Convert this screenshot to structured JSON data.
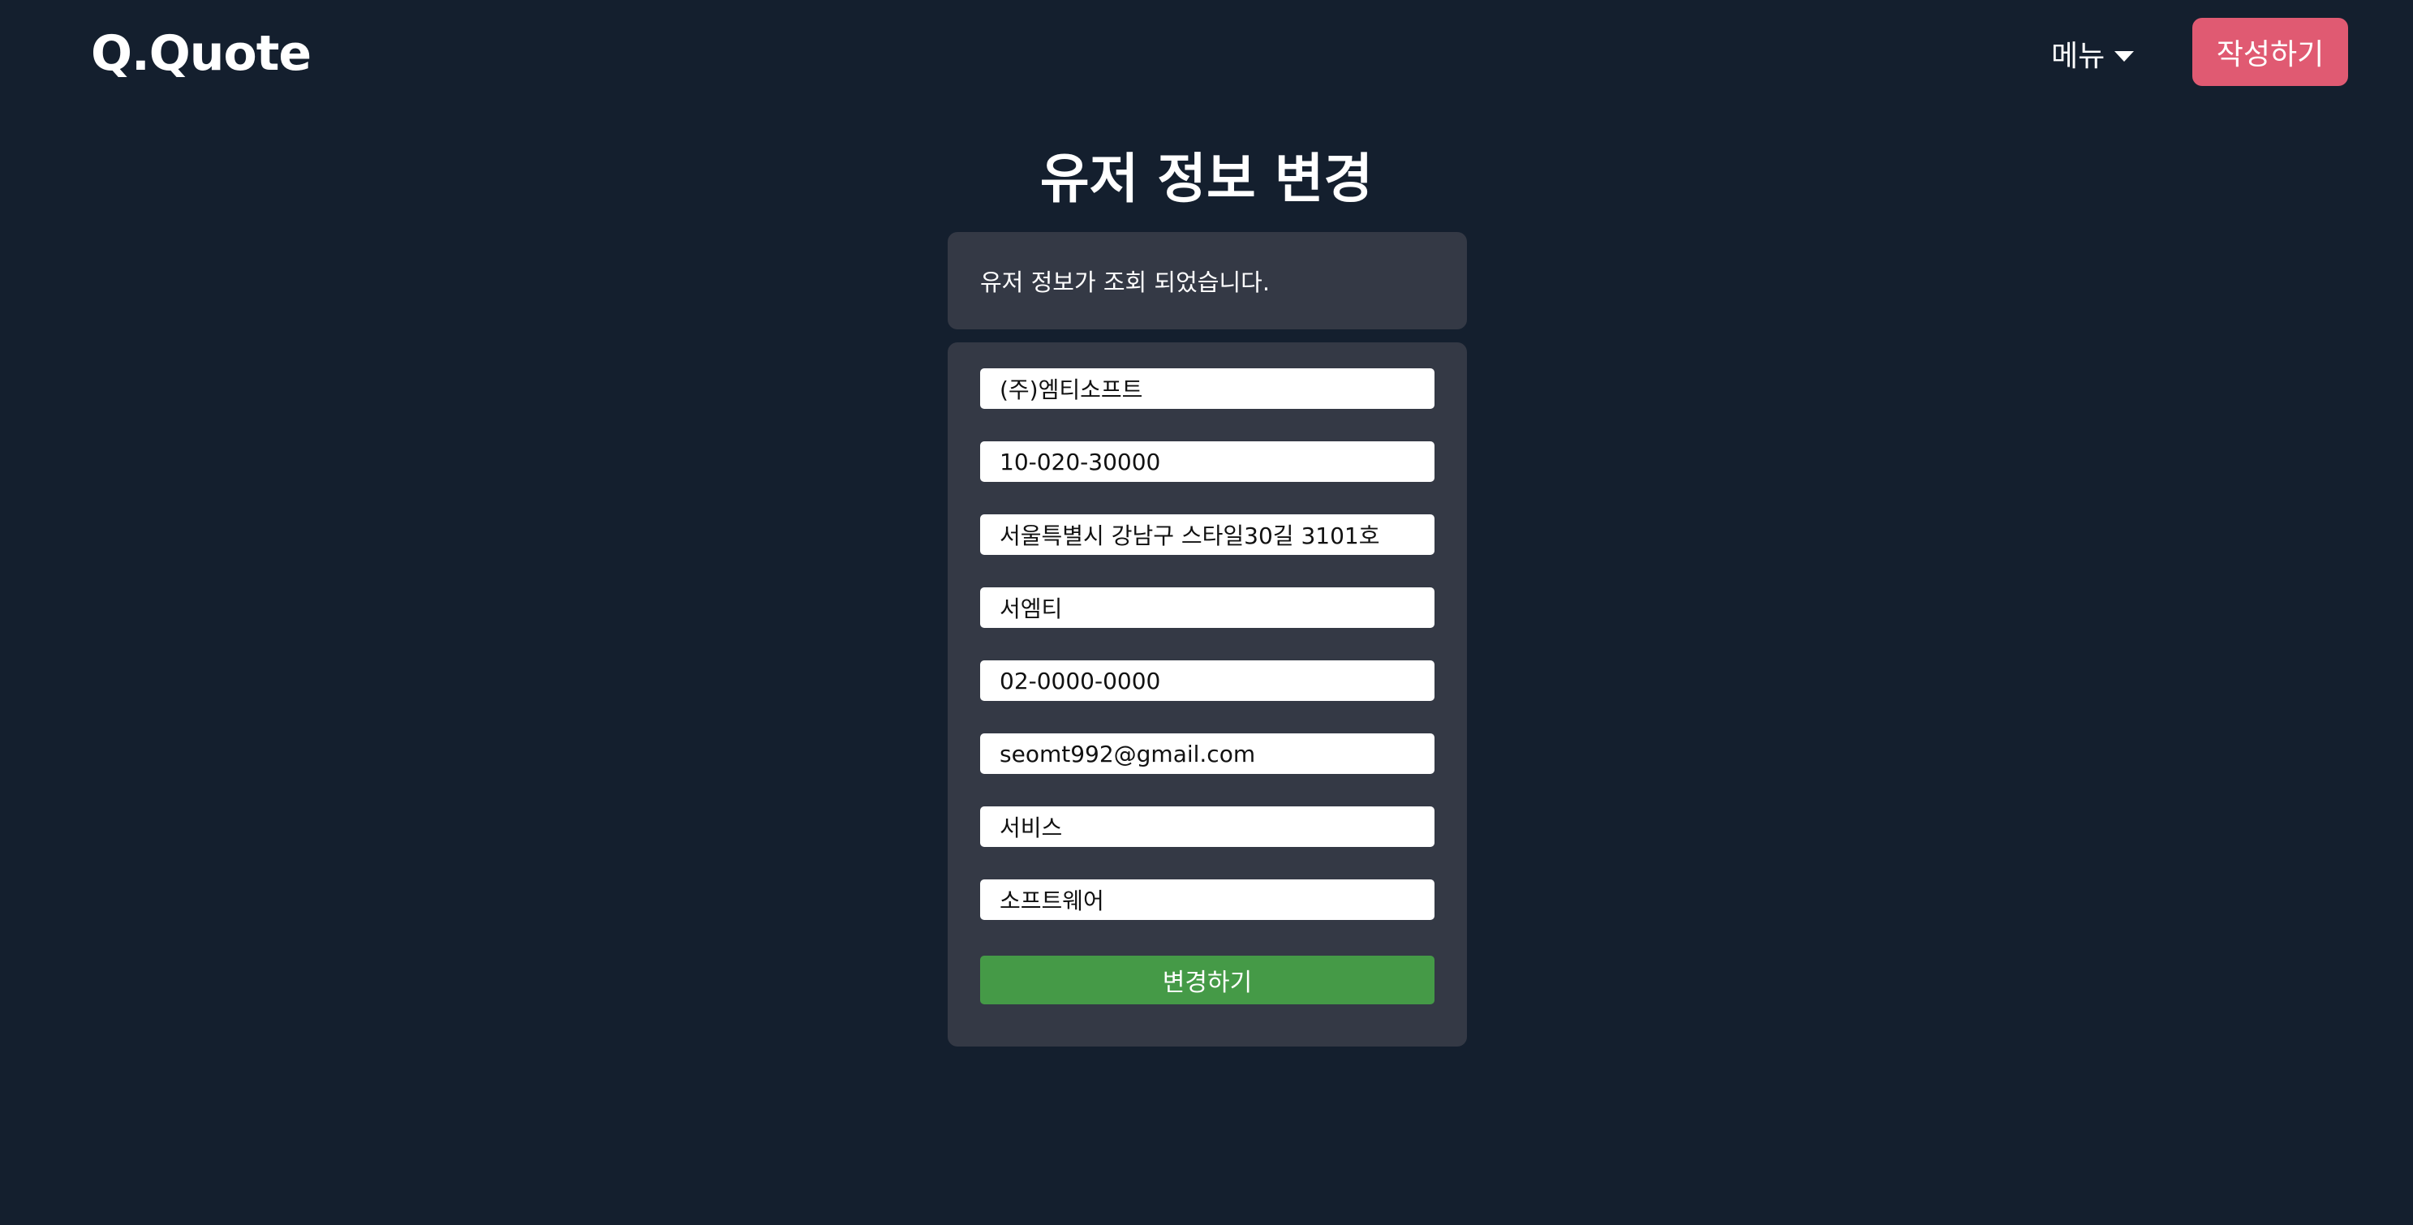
{
  "header": {
    "logo": "Q.Quote",
    "menu_label": "메뉴",
    "write_label": "작성하기"
  },
  "page": {
    "title": "유저 정보 변경",
    "notice": "유저 정보가 조회 되었습니다."
  },
  "form": {
    "fields": [
      {
        "value": "(주)엠티소프트"
      },
      {
        "value": "10-020-30000"
      },
      {
        "value": "서울특별시 강남구 스타일30길 3101호"
      },
      {
        "value": "서엠티"
      },
      {
        "value": "02-0000-0000"
      },
      {
        "value": "seomt992@gmail.com"
      },
      {
        "value": "서비스"
      },
      {
        "value": "소프트웨어"
      }
    ],
    "submit_label": "변경하기"
  },
  "colors": {
    "background": "#141f2e",
    "card": "#343945",
    "accent_button": "#e05a72",
    "submit_button": "#459a47"
  },
  "icons": {
    "menu_caret": "caret-down-icon"
  }
}
